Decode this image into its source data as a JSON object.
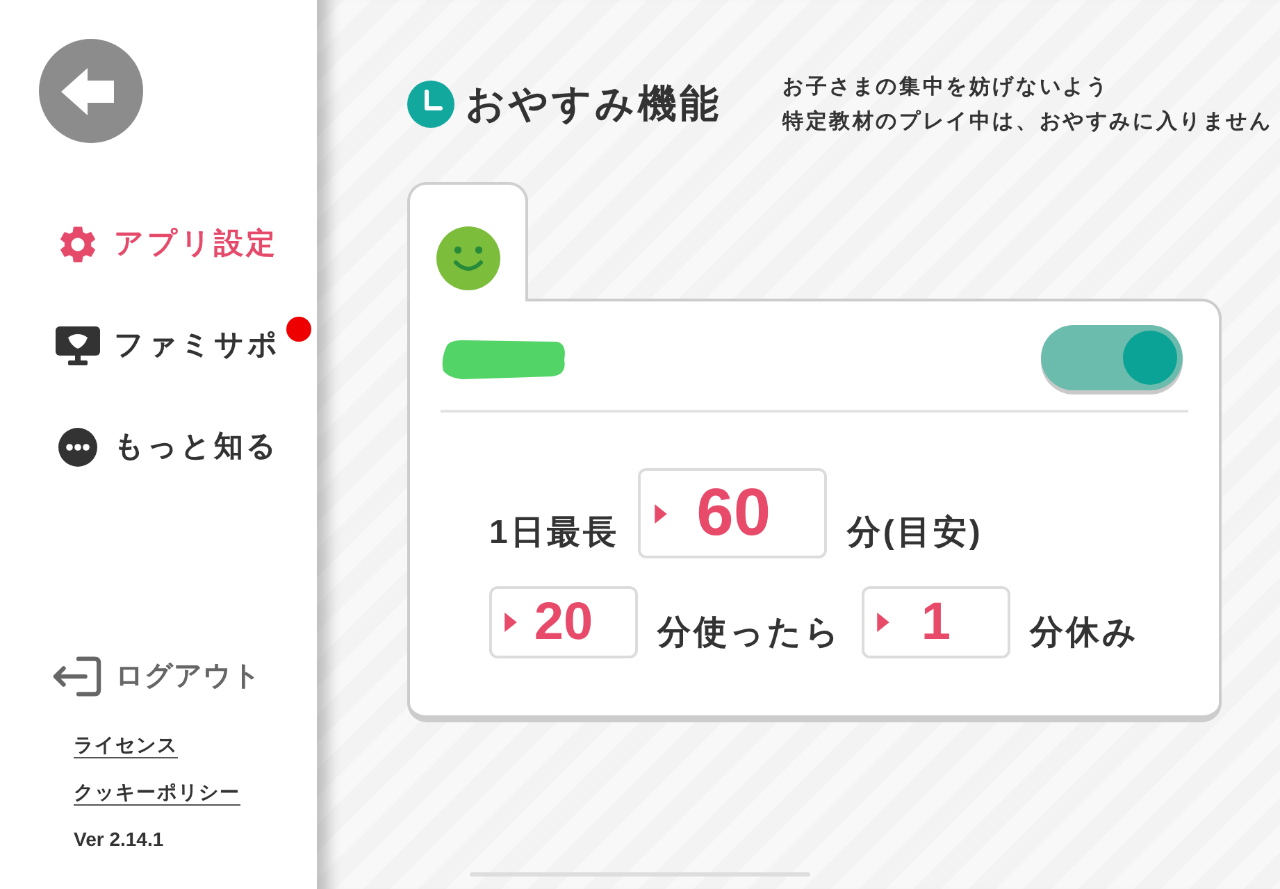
{
  "sidebar": {
    "nav_items": [
      {
        "kind": "settings",
        "label": "アプリ設定",
        "selected": true,
        "notification": false
      },
      {
        "kind": "support",
        "label": "ファミサポ",
        "selected": false,
        "notification": true
      },
      {
        "kind": "more",
        "label": "もっと知る",
        "selected": false,
        "notification": false
      }
    ],
    "logout": {
      "label": "ログアウト"
    },
    "links": [
      "ライセンス",
      "クッキーポリシー"
    ],
    "version": "Ver 2.14.1"
  },
  "section": {
    "title": "おやすみ機能",
    "description": [
      "お子さまの集中を妨げないよう",
      "特定教材のプレイ中は、おやすみに入りません"
    ]
  },
  "card": {
    "toggle": {
      "on": true
    },
    "rows": [
      {
        "parts": [
          {
            "kind": "label",
            "text": "1日最長"
          },
          {
            "kind": "large_field",
            "value": "60"
          },
          {
            "kind": "label",
            "text": "分(目安)"
          }
        ]
      },
      {
        "parts": [
          {
            "kind": "field",
            "value": "20"
          },
          {
            "kind": "label",
            "text": "分使ったら"
          },
          {
            "kind": "field",
            "value": "1"
          },
          {
            "kind": "label",
            "text": "分休み"
          }
        ]
      }
    ]
  }
}
